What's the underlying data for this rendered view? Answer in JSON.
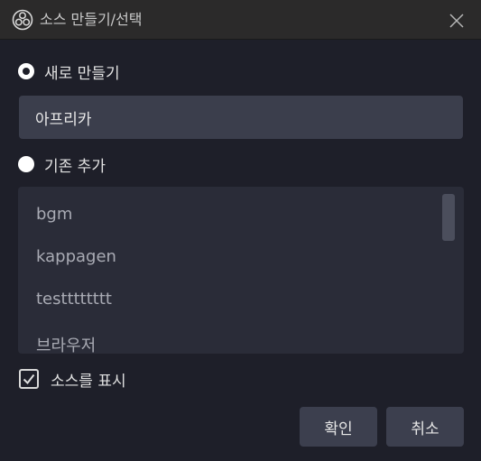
{
  "window": {
    "title": "소스 만들기/선택",
    "app_icon": "obs-logo-icon",
    "close_icon": "close-icon"
  },
  "create_new": {
    "label": "새로 만들기",
    "selected": true,
    "name_value": "아프리카"
  },
  "add_existing": {
    "label": "기존 추가",
    "selected": false,
    "items": [
      "bgm",
      "kappagen",
      "testttttttt",
      "브라우저"
    ]
  },
  "visible_option": {
    "label": "소스를 표시",
    "checked": true
  },
  "buttons": {
    "ok": "확인",
    "cancel": "취소"
  },
  "colors": {
    "background": "#1e1f29",
    "titlebar": "#2b2a2a",
    "input": "#3b3e4c",
    "list": "#2a2c38",
    "button": "#3c3f4e"
  }
}
